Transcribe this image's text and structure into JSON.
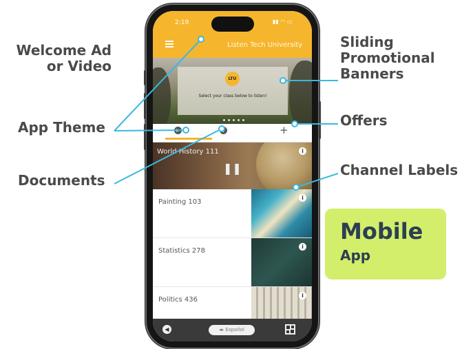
{
  "callouts": {
    "welcome": [
      "Welcome Ad",
      "or Video"
    ],
    "app_theme": "App Theme",
    "documents": "Documents",
    "sliding": [
      "Sliding",
      "Promotional",
      "Banners"
    ],
    "offers": "Offers",
    "channel_labels": "Channel Labels"
  },
  "badge": {
    "title": "Mobile",
    "subtitle": "App"
  },
  "phone": {
    "status_time": "2:19",
    "status_icons": "signal, wifi, battery",
    "app_title": "Listen Tech University",
    "banner": {
      "logo_text": "LTU",
      "prompt": "Select your class below to listen!",
      "slide_count": 5
    },
    "channels": [
      {
        "name": "World History 111",
        "state": "playing"
      },
      {
        "name": "Painting 103"
      },
      {
        "name": "Statistics 278"
      },
      {
        "name": "Politics 436"
      }
    ],
    "bottom_bar": {
      "language_button": "Español"
    }
  },
  "colors": {
    "brand_yellow": "#f5b62d",
    "callout_line": "#3bb8e0",
    "badge_green": "#d2ee6b",
    "badge_text": "#2d3e52"
  }
}
